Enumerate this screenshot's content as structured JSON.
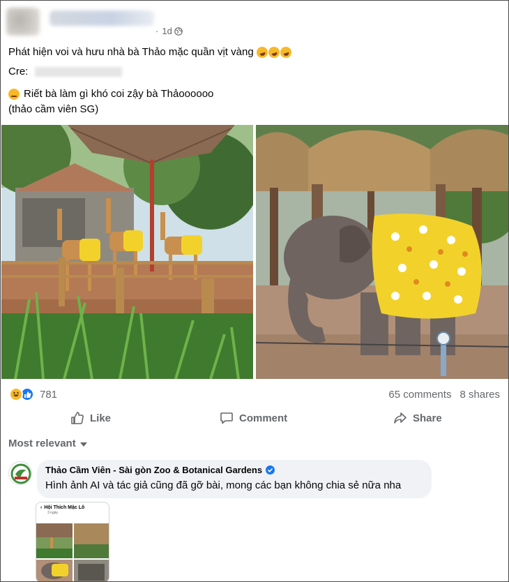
{
  "post": {
    "time": "1d",
    "line1": "Phát hiện voi và hưu nhà bà Thảo mặc quần vịt vàng",
    "cre_label": "Cre:",
    "line3": "Riết bà làm gì khó coi zậy bà Thảoooooo",
    "line4": "(thảo cầm viên SG)"
  },
  "reactions": {
    "count": "781",
    "comments": "65 comments",
    "shares": "8 shares"
  },
  "actions": {
    "like": "Like",
    "comment": "Comment",
    "share": "Share"
  },
  "filter": {
    "label": "Most relevant"
  },
  "comment": {
    "author": "Thảo Cầm Viên - Sài gòn Zoo & Botanical Gardens",
    "text": "Hình ảnh AI và tác giả cũng đã gỡ bài, mong các bạn không chia sẻ nữa nha",
    "attachment": {
      "title": "Hội Thích Mặc Lô",
      "subtitle": "3 ngày"
    }
  },
  "colors": {
    "meta_gray": "#65676b",
    "like_blue": "#1877f2",
    "reaction_yellow": "#f7b928",
    "bubble_bg": "#f0f2f5"
  },
  "icons": [
    "globe-icon",
    "laugh-reaction-icon",
    "like-reaction-icon",
    "thumbs-up-icon",
    "comment-icon",
    "share-icon",
    "chevron-down-icon",
    "verified-badge-icon"
  ]
}
